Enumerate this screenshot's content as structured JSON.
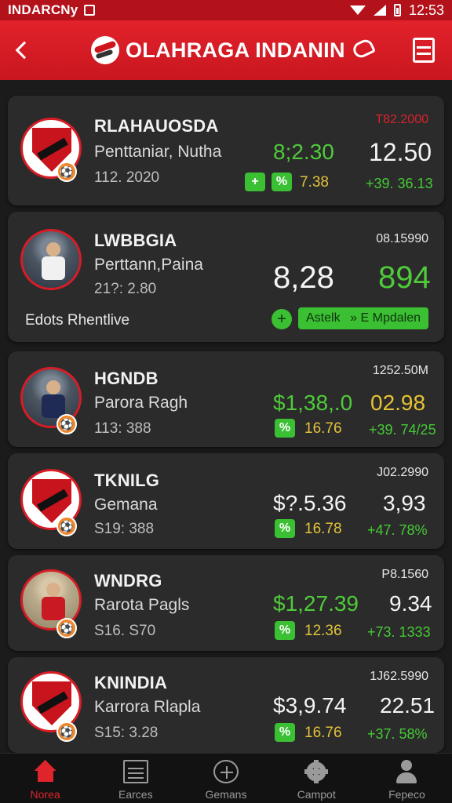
{
  "status_bar": {
    "carrier": "INDARCNy",
    "time": "12:53"
  },
  "app_bar": {
    "title": "OLAHRAGA INDANIN",
    "back_icon": "chevron-left-icon",
    "actions": [
      "tag-icon",
      "menu-list-icon"
    ]
  },
  "cards": [
    {
      "name": "RLAHAUOSDA",
      "subtitle": "Penttaniar, Nutha",
      "meta": "112. 2020",
      "id": "T82.2000",
      "value1": "8;2.30",
      "value2": "12.50",
      "btn1": "+",
      "btn2": "%",
      "small": "7.38",
      "pct": "+39. 36.13"
    },
    {
      "name": "LWBBGIA",
      "subtitle": "Perttann,Paina",
      "meta": "21?: 2.80",
      "id": "08.15990",
      "value1": "8,28",
      "value2": "894",
      "note": "Edots Rhentlive",
      "circle_btn": "+",
      "pill_left": "Astelk",
      "pill_right": "» E Mpdalen"
    },
    {
      "name": "HGNDB",
      "subtitle": "Parora Ragh",
      "meta": "113: 388",
      "id": "1252.50M",
      "value1": "$1,38,.0",
      "value2": "02.98",
      "btn": "%",
      "small": "16.76",
      "pct": "+39. 74/25"
    },
    {
      "name": "TKNILG",
      "subtitle": "Gemana",
      "meta": "S19: 388",
      "id": "J02.2990",
      "value1": "$?.5.36",
      "value2": "3,93",
      "btn": "%",
      "small": "16.78",
      "pct": "+47. 78%"
    },
    {
      "name": "WNDRG",
      "subtitle": "Rarota Pagls",
      "meta": "S16. S70",
      "id": "P8.1560",
      "value1": "$1,27.39",
      "value2": "9.34",
      "btn": "%",
      "small": "12.36",
      "pct": "+73. 1333"
    },
    {
      "name": "KNINDIA",
      "subtitle": "Karrora Rlapla",
      "meta": "S15: 3.28",
      "id": "1J62.5990",
      "value1": "$3,9.74",
      "value2": "22.51",
      "btn": "%",
      "small": "16.76",
      "pct": "+37. 58%"
    }
  ],
  "bottom_nav": [
    {
      "label": "Norea",
      "icon": "home-icon",
      "active": true
    },
    {
      "label": "Earces",
      "icon": "grid-icon",
      "active": false
    },
    {
      "label": "Gemans",
      "icon": "plus-circle-icon",
      "active": false
    },
    {
      "label": "Campot",
      "icon": "gear-icon",
      "active": false
    },
    {
      "label": "Fepeco",
      "icon": "user-icon",
      "active": false
    }
  ],
  "colors": {
    "brand_red": "#d61d26",
    "gain_green": "#4fcb3a",
    "highlight_yellow": "#e7c232",
    "card_bg": "#2b2b2b"
  }
}
